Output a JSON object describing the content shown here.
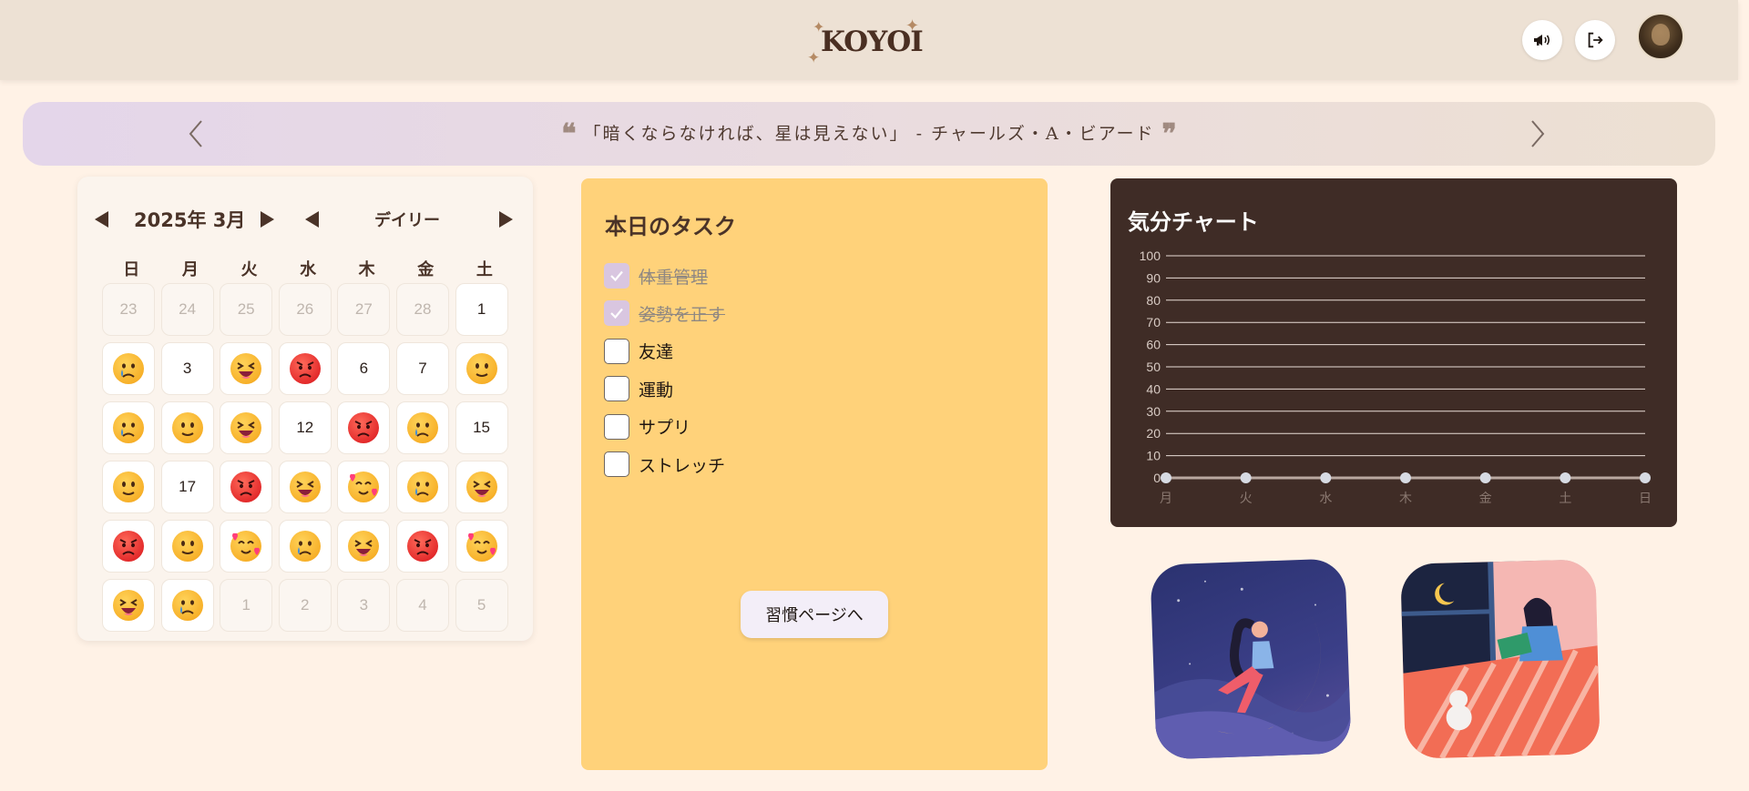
{
  "header": {
    "logo": "KOYOI",
    "announcement_icon": "megaphone-icon",
    "logout_icon": "logout-icon",
    "avatar": "user-avatar"
  },
  "quote": {
    "open_mark": "❝",
    "text": "「暗くならなければ、星は見えない」 - チャールズ・A・ビアード",
    "close_mark": "❞"
  },
  "calendar": {
    "month_label": "2025年 3月",
    "view_label": "デイリー",
    "weekdays": [
      "日",
      "月",
      "火",
      "水",
      "木",
      "金",
      "土"
    ],
    "days": [
      {
        "label": "23",
        "other": true
      },
      {
        "label": "24",
        "other": true
      },
      {
        "label": "25",
        "other": true
      },
      {
        "label": "26",
        "other": true
      },
      {
        "label": "27",
        "other": true
      },
      {
        "label": "28",
        "other": true
      },
      {
        "label": "1"
      },
      {
        "mood": "cry"
      },
      {
        "label": "3"
      },
      {
        "mood": "laugh"
      },
      {
        "mood": "angry"
      },
      {
        "label": "6"
      },
      {
        "label": "7"
      },
      {
        "mood": "neutral"
      },
      {
        "mood": "cry"
      },
      {
        "mood": "neutral"
      },
      {
        "mood": "laugh"
      },
      {
        "label": "12"
      },
      {
        "mood": "angry"
      },
      {
        "mood": "cry"
      },
      {
        "label": "15"
      },
      {
        "mood": "neutral"
      },
      {
        "label": "17"
      },
      {
        "mood": "angry"
      },
      {
        "mood": "laugh"
      },
      {
        "mood": "love"
      },
      {
        "mood": "cry"
      },
      {
        "mood": "laugh"
      },
      {
        "mood": "angry"
      },
      {
        "mood": "neutral"
      },
      {
        "mood": "love"
      },
      {
        "mood": "cry"
      },
      {
        "mood": "laugh"
      },
      {
        "mood": "angry"
      },
      {
        "mood": "love"
      },
      {
        "mood": "laugh"
      },
      {
        "mood": "cry"
      },
      {
        "label": "1",
        "other": true
      },
      {
        "label": "2",
        "other": true
      },
      {
        "label": "3",
        "other": true
      },
      {
        "label": "4",
        "other": true
      },
      {
        "label": "5",
        "other": true
      }
    ]
  },
  "tasks": {
    "title": "本日のタスク",
    "items": [
      {
        "label": "体重管理",
        "done": true
      },
      {
        "label": "姿勢を正す",
        "done": true
      },
      {
        "label": "友達",
        "done": false
      },
      {
        "label": "運動",
        "done": false
      },
      {
        "label": "サプリ",
        "done": false
      },
      {
        "label": "ストレッチ",
        "done": false
      }
    ],
    "button_label": "習慣ページへ"
  },
  "chart_data": {
    "type": "line",
    "title": "気分チャート",
    "categories": [
      "月",
      "火",
      "水",
      "木",
      "金",
      "土",
      "日"
    ],
    "series": [
      {
        "values": [
          0,
          0,
          0,
          0,
          0,
          0,
          0
        ]
      }
    ],
    "ylim": [
      0,
      100
    ],
    "yticks": [
      0,
      10,
      20,
      30,
      40,
      50,
      60,
      70,
      80,
      90,
      100
    ],
    "grid": true,
    "colors": {
      "background": "#3f2c26",
      "grid": "#e9ddd6",
      "point": "#d7dbe3"
    }
  },
  "illustrations": [
    {
      "name": "girl-on-moon-illustration"
    },
    {
      "name": "girl-reading-in-bed-illustration"
    }
  ]
}
